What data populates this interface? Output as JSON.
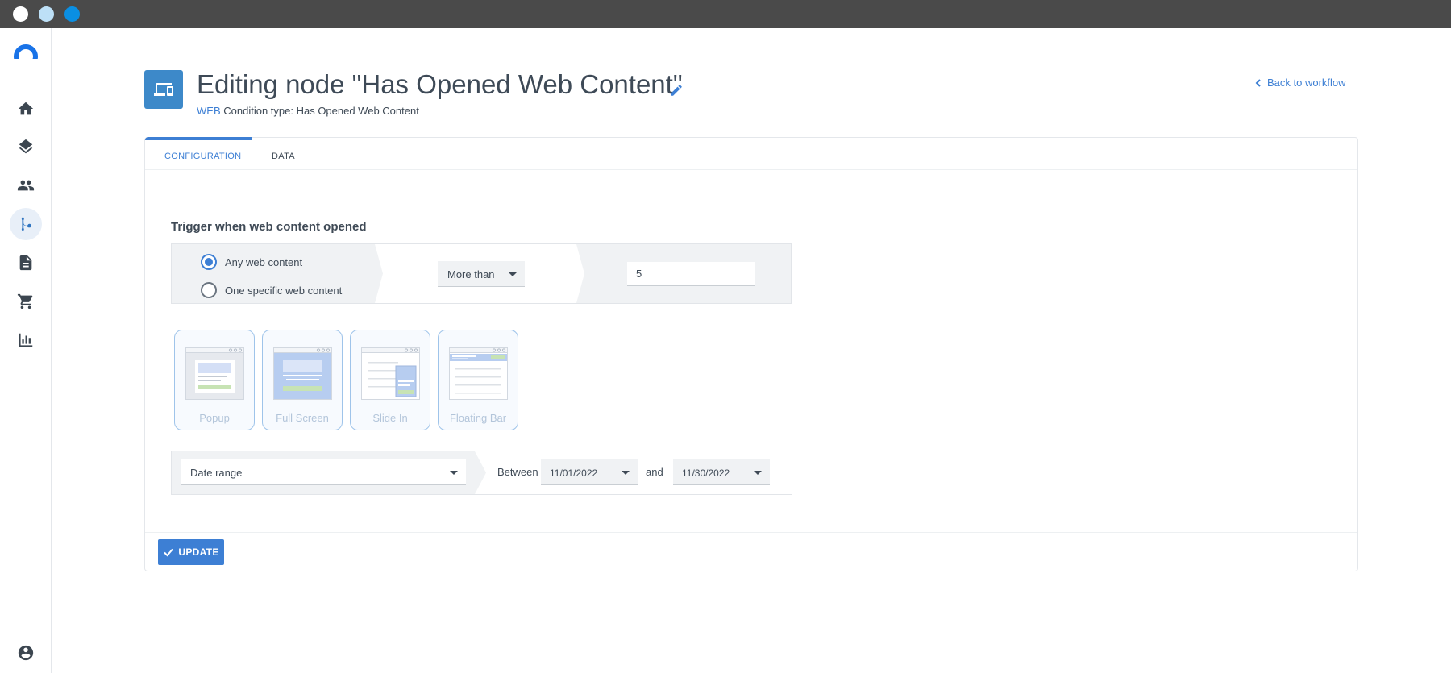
{
  "colors": {
    "accent": "#3d7fd4",
    "header_icon_bg": "#3d89c9",
    "titlebar": "#4a4a4a"
  },
  "window": {
    "buttons": [
      "close",
      "minimize",
      "maximize"
    ]
  },
  "sidebar": {
    "items": [
      {
        "icon": "home-icon",
        "active": false
      },
      {
        "icon": "layers-icon",
        "active": false
      },
      {
        "icon": "people-icon",
        "active": false
      },
      {
        "icon": "workflow-icon",
        "active": true
      },
      {
        "icon": "document-icon",
        "active": false
      },
      {
        "icon": "cart-icon",
        "active": false
      },
      {
        "icon": "bar-chart-icon",
        "active": false
      },
      {
        "icon": "account-icon",
        "active": false
      }
    ]
  },
  "header": {
    "icon": "devices-icon",
    "title": "Editing node \"Has Opened Web Content\"",
    "subtitle_tag": "WEB",
    "subtitle_text": "Condition type: Has Opened Web Content",
    "back_link": "Back to workflow"
  },
  "tabs": [
    {
      "label": "CONFIGURATION",
      "active": true
    },
    {
      "label": "DATA",
      "active": false
    }
  ],
  "trigger": {
    "title": "Trigger when web content opened",
    "options": [
      {
        "label": "Any web content",
        "selected": true
      },
      {
        "label": "One specific web content",
        "selected": false
      }
    ],
    "comparator": "More than",
    "count": "5"
  },
  "content_types": [
    {
      "label": "Popup"
    },
    {
      "label": "Full Screen"
    },
    {
      "label": "Slide In"
    },
    {
      "label": "Floating Bar"
    }
  ],
  "date_filter": {
    "mode": "Date range",
    "between_label": "Between",
    "from": "11/01/2022",
    "and_label": "and",
    "to": "11/30/2022"
  },
  "footer": {
    "update_label": "UPDATE"
  }
}
